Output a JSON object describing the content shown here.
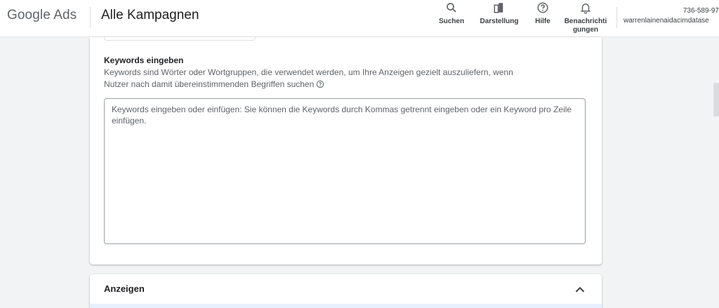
{
  "header": {
    "logo": "Google Ads",
    "page_title": "Alle Kampagnen",
    "tools": [
      {
        "label": "Suchen",
        "icon": "search-icon"
      },
      {
        "label": "Darstellung",
        "icon": "appearance-icon"
      },
      {
        "label": "Hilfe",
        "icon": "help-icon"
      },
      {
        "label": "Benachrichti gungen",
        "icon": "bell-icon"
      }
    ],
    "account": {
      "id": "736-589-97",
      "name": "warrenlainenaidacimdatase"
    }
  },
  "keywords": {
    "title": "Keywords eingeben",
    "description": "Keywords sind Wörter oder Wortgruppen, die verwendet werden, um Ihre Anzeigen gezielt auszuliefern, wenn Nutzer nach damit übereinstimmenden Begriffen suchen",
    "placeholder": "Keywords eingeben oder einfügen: Sie können die Keywords durch Kommas getrennt eingeben oder ein Keyword pro Zeile einfügen.",
    "value": ""
  },
  "ads": {
    "title": "Anzeigen"
  },
  "colors": {
    "text": "#202124",
    "secondary": "#5f6368",
    "background": "#f1f3f4"
  }
}
